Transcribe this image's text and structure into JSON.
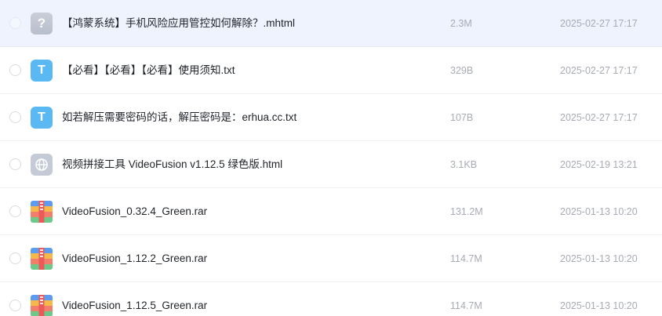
{
  "files": [
    {
      "name": "【鸿蒙系统】手机风险应用管控如何解除？.mhtml",
      "size": "2.3M",
      "date": "2025-02-27 17:17",
      "icon": "unknown-file-icon",
      "icon_glyph": "?",
      "selected": true
    },
    {
      "name": "【必看】【必看】【必看】使用须知.txt",
      "size": "329B",
      "date": "2025-02-27 17:17",
      "icon": "text-file-icon",
      "icon_glyph": "T",
      "selected": false
    },
    {
      "name": "如若解压需要密码的话，解压密码是：erhua.cc.txt",
      "size": "107B",
      "date": "2025-02-27 17:17",
      "icon": "text-file-icon",
      "icon_glyph": "T",
      "selected": false
    },
    {
      "name": "视频拼接工具 VideoFusion v1.12.5 绿色版.html",
      "size": "3.1KB",
      "date": "2025-02-19 13:21",
      "icon": "web-file-icon",
      "selected": false
    },
    {
      "name": "VideoFusion_0.32.4_Green.rar",
      "size": "131.2M",
      "date": "2025-01-13 10:20",
      "icon": "archive-file-icon",
      "selected": false
    },
    {
      "name": "VideoFusion_1.12.2_Green.rar",
      "size": "114.7M",
      "date": "2025-01-13 10:20",
      "icon": "archive-file-icon",
      "selected": false
    },
    {
      "name": "VideoFusion_1.12.5_Green.rar",
      "size": "114.7M",
      "date": "2025-01-13 10:20",
      "icon": "archive-file-icon",
      "selected": false
    }
  ],
  "colors": {
    "selected_row_bg": "#eef3fe",
    "text_icon": "#5ab8f2",
    "unknown_icon": "#c4cad6",
    "meta_text": "#a7abb3"
  }
}
